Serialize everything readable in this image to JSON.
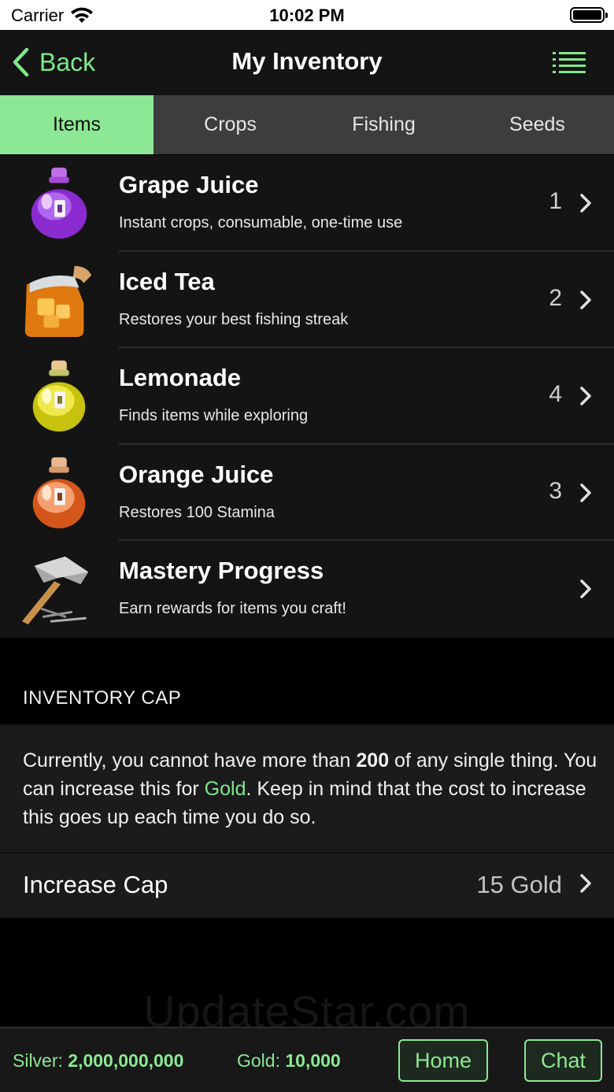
{
  "status_bar": {
    "carrier": "Carrier",
    "time": "10:02 PM"
  },
  "nav": {
    "back_label": "Back",
    "title": "My Inventory"
  },
  "tabs": [
    {
      "label": "Items",
      "active": true
    },
    {
      "label": "Crops",
      "active": false
    },
    {
      "label": "Fishing",
      "active": false
    },
    {
      "label": "Seeds",
      "active": false
    }
  ],
  "items": [
    {
      "title": "Grape Juice",
      "description": "Instant crops, consumable, one-time use",
      "count": "1",
      "icon": "grape-juice-potion-icon"
    },
    {
      "title": "Iced Tea",
      "description": "Restores your best fishing streak",
      "count": "2",
      "icon": "iced-tea-jug-icon"
    },
    {
      "title": "Lemonade",
      "description": "Finds items while exploring",
      "count": "4",
      "icon": "lemonade-potion-icon"
    },
    {
      "title": "Orange Juice",
      "description": "Restores 100 Stamina",
      "count": "3",
      "icon": "orange-juice-potion-icon"
    },
    {
      "title": "Mastery Progress",
      "description": "Earn rewards for items you craft!",
      "count": "",
      "icon": "hammer-nails-icon"
    }
  ],
  "inventory_cap": {
    "header": "INVENTORY CAP",
    "text_part1": "Currently, you cannot have more than ",
    "text_amount": "200",
    "text_part2": " of any single thing. You can increase this for ",
    "text_currency": "Gold",
    "text_part3": ". Keep in mind that the cost to increase this goes up each time you do so.",
    "increase_label": "Increase Cap",
    "increase_cost": "15 Gold"
  },
  "watermark": "UpdateStar.com",
  "footer": {
    "silver_label": "Silver: ",
    "silver_value": "2,000,000,000",
    "gold_label": "Gold: ",
    "gold_value": "10,000",
    "home_label": "Home",
    "chat_label": "Chat"
  },
  "colors": {
    "accent": "#7ee88a",
    "active_tab": "#8ce894",
    "background": "#141414"
  }
}
